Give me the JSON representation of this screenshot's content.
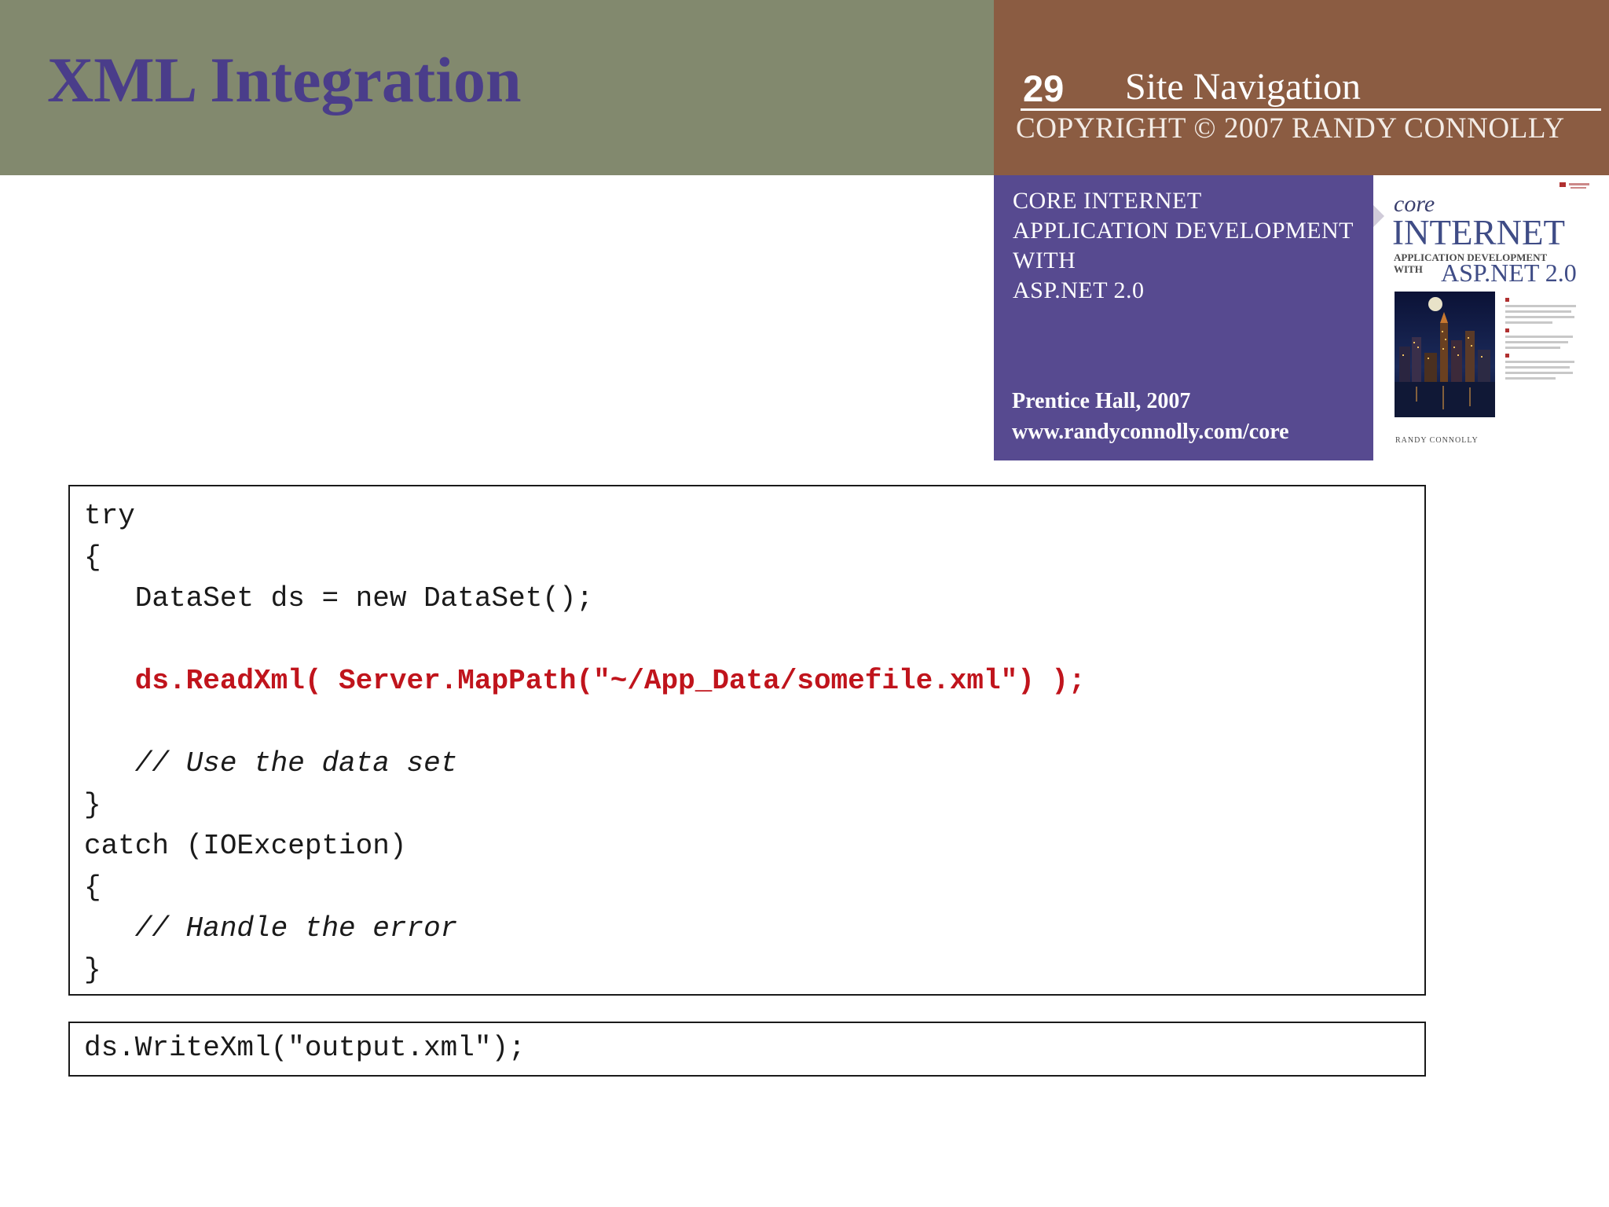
{
  "header": {
    "title": "XML Integration",
    "slide_number": "29",
    "section": "Site Navigation",
    "copyright": "COPYRIGHT © 2007 RANDY CONNOLLY"
  },
  "book": {
    "title_lines": [
      "CORE INTERNET",
      "APPLICATION DEVELOPMENT",
      "WITH",
      "ASP.NET 2.0"
    ],
    "publisher": "Prentice Hall, 2007",
    "url": "www.randyconnolly.com/core",
    "cover": {
      "core": "core",
      "internet": "INTERNET",
      "subtitle": "APPLICATION DEVELOPMENT",
      "with": "WITH",
      "asp": "ASP.NET 2.0",
      "author": "RANDY CONNOLLY"
    }
  },
  "code_main": {
    "lines": [
      "try",
      "{",
      "   DataSet ds = new DataSet();",
      "",
      "   ds.ReadXml( Server.MapPath(\"~/App_Data/somefile.xml\") );",
      "",
      "   // Use the data set",
      "}",
      "catch (IOException)",
      "{",
      "   // Handle the error",
      "}"
    ]
  },
  "code_secondary": {
    "line": "ds.WriteXml(\"output.xml\");"
  },
  "colors": {
    "title_band": "#82896e",
    "title_text": "#4a3d8a",
    "info_band": "#8b5c42",
    "book_panel": "#574a90",
    "code_highlight": "#c0141c"
  }
}
